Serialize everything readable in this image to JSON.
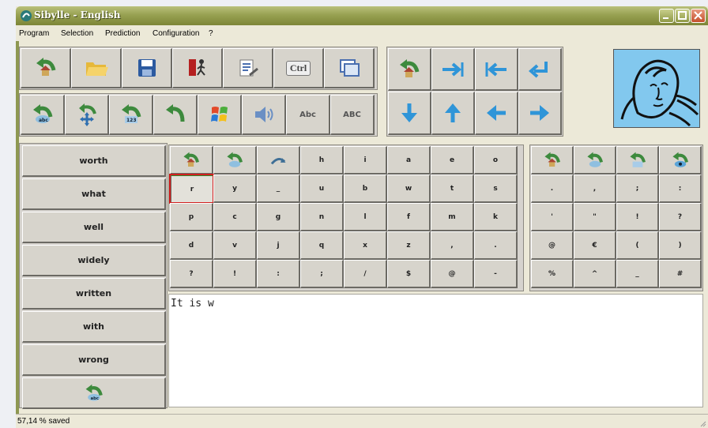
{
  "window": {
    "title": "Sibylle - English"
  },
  "menu": [
    {
      "id": "program",
      "label": "Program"
    },
    {
      "id": "selection",
      "label": "Selection"
    },
    {
      "id": "prediction",
      "label": "Prediction"
    },
    {
      "id": "configuration",
      "label": "Configuration"
    },
    {
      "id": "help",
      "label": "?"
    }
  ],
  "toolbar": {
    "row1": [
      {
        "id": "home",
        "icon": "home-arrow-icon"
      },
      {
        "id": "open",
        "icon": "folder-icon"
      },
      {
        "id": "save",
        "icon": "floppy-disk-icon"
      },
      {
        "id": "exit",
        "icon": "exit-door-icon"
      },
      {
        "id": "edit",
        "icon": "document-edit-icon"
      },
      {
        "id": "ctrl",
        "icon": "ctrl-key-icon",
        "label": "Ctrl"
      },
      {
        "id": "window",
        "icon": "window-icon"
      }
    ],
    "row2": [
      {
        "id": "home-abc",
        "icon": "home-abc-icon"
      },
      {
        "id": "move",
        "icon": "move-arrows-icon"
      },
      {
        "id": "home-123",
        "icon": "home-123-icon"
      },
      {
        "id": "undo",
        "icon": "undo-arrow-icon"
      },
      {
        "id": "windows",
        "icon": "windows-logo-icon"
      },
      {
        "id": "speak",
        "icon": "speaker-icon"
      },
      {
        "id": "abc-lower",
        "label": "Abc"
      },
      {
        "id": "abc-upper",
        "label": "ABC"
      }
    ],
    "nav": [
      {
        "id": "nav-home",
        "icon": "home-arrow-icon"
      },
      {
        "id": "tab-right",
        "icon": "tab-right-icon"
      },
      {
        "id": "tab-left",
        "icon": "tab-left-icon"
      },
      {
        "id": "enter",
        "icon": "enter-icon"
      },
      {
        "id": "down",
        "icon": "arrow-down-icon"
      },
      {
        "id": "up",
        "icon": "arrow-up-icon"
      },
      {
        "id": "left",
        "icon": "arrow-left-icon"
      },
      {
        "id": "right",
        "icon": "arrow-right-icon"
      }
    ]
  },
  "predictions": [
    "worth",
    "what",
    "well",
    "widely",
    "written",
    "with",
    "wrong"
  ],
  "prediction_home_icon": "home-abc-icon",
  "keyboard": {
    "icons": [
      "home-arrow-icon",
      "home-abc-icon",
      "undo-curve-icon"
    ],
    "row0": [
      "h",
      "i",
      "a",
      "e",
      "o"
    ],
    "rows": [
      [
        "r",
        "y",
        "_",
        "u",
        "b",
        "w",
        "t",
        "s"
      ],
      [
        "p",
        "c",
        "g",
        "n",
        "l",
        "f",
        "m",
        "k"
      ],
      [
        "d",
        "v",
        "j",
        "q",
        "x",
        "z",
        ",",
        "."
      ],
      [
        "?",
        "!",
        ":",
        ";",
        "/",
        "$",
        "@",
        "-"
      ]
    ],
    "selected_key": "r"
  },
  "punct": {
    "icons": [
      "home-arrow-icon",
      "home-abc-icon",
      "home-123-icon",
      "home-eye-icon"
    ],
    "rows": [
      [
        ".",
        ",",
        ";",
        ":"
      ],
      [
        "'",
        "\"",
        "!",
        "?"
      ],
      [
        "@",
        "€",
        "(",
        ")"
      ],
      [
        "%",
        "^",
        "_",
        "#"
      ]
    ]
  },
  "text": {
    "value": "It is w"
  },
  "status": {
    "text": "57,14 % saved"
  },
  "colors": {
    "accent_arrow": "#2f95d8",
    "home_icon": "#3d8a3d",
    "selection": "#d11f1f",
    "title_bar": "#8f9946"
  }
}
